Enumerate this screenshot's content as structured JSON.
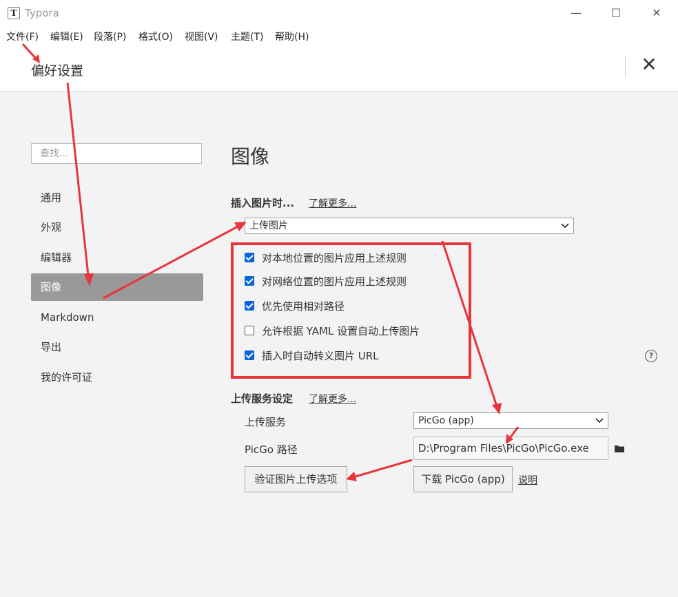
{
  "window": {
    "app_icon_letter": "T",
    "title": "Typora",
    "min_glyph": "—",
    "max_glyph": "☐",
    "close_glyph": "✕"
  },
  "menu": [
    "文件(F)",
    "编辑(E)",
    "段落(P)",
    "格式(O)",
    "视图(V)",
    "主题(T)",
    "帮助(H)"
  ],
  "preferences": {
    "title": "偏好设置",
    "close_glyph": "✕"
  },
  "sidebar": {
    "search_placeholder": "查找...",
    "items": [
      {
        "label": "通用",
        "active": false
      },
      {
        "label": "外观",
        "active": false
      },
      {
        "label": "编辑器",
        "active": false
      },
      {
        "label": "图像",
        "active": true
      },
      {
        "label": "Markdown",
        "active": false
      },
      {
        "label": "导出",
        "active": false
      },
      {
        "label": "我的许可证",
        "active": false
      }
    ]
  },
  "main": {
    "heading": "图像",
    "insert_label": "插入图片时...",
    "insert_learn_more": "了解更多...",
    "insert_select_value": "上传图片",
    "options": [
      {
        "label": "对本地位置的图片应用上述规则",
        "checked": true
      },
      {
        "label": "对网络位置的图片应用上述规则",
        "checked": true
      },
      {
        "label": "优先使用相对路径",
        "checked": true
      },
      {
        "label": "允许根据 YAML 设置自动上传图片",
        "checked": false
      },
      {
        "label": "插入时自动转义图片 URL",
        "checked": true
      }
    ],
    "upload_label": "上传服务设定",
    "upload_learn_more": "了解更多...",
    "service_label": "上传服务",
    "service_value": "PicGo (app)",
    "path_label": "PicGo 路径",
    "path_value": "D:\\Program Files\\PicGo\\PicGo.exe",
    "verify_button": "验证图片上传选项",
    "download_button": "下载 PicGo (app)",
    "explain_link": "说明",
    "help_glyph": "?"
  },
  "annotation_colors": {
    "arrow": "#e8343b"
  }
}
